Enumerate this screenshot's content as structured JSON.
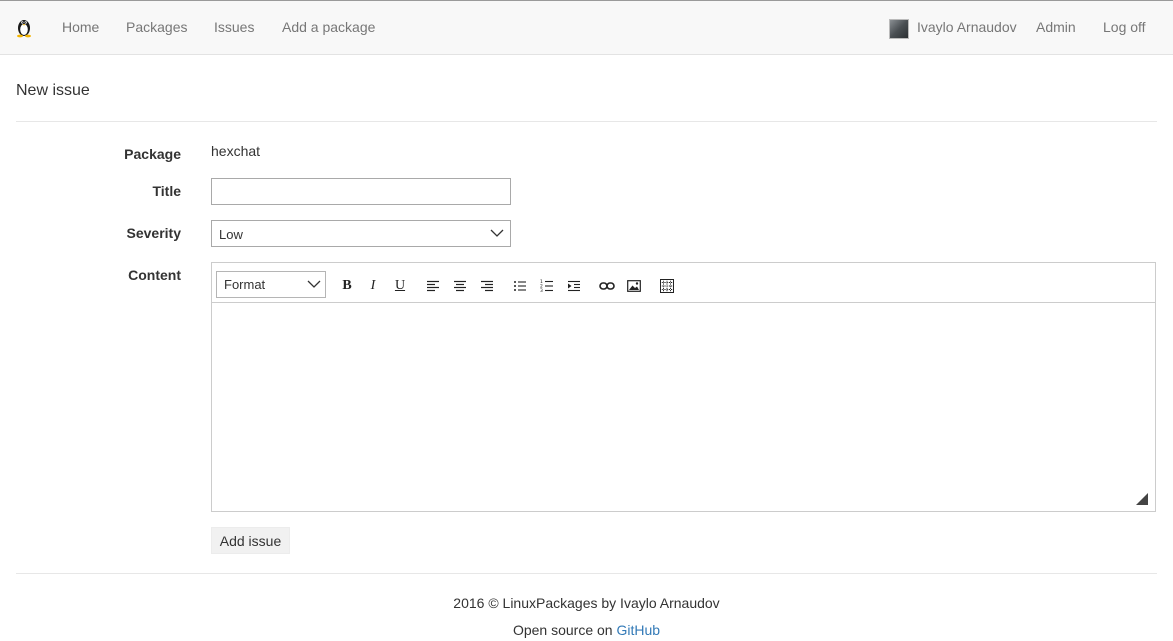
{
  "navbar": {
    "brand_icon": "tux-penguin-icon",
    "links": {
      "home": "Home",
      "packages": "Packages",
      "issues": "Issues",
      "add_package": "Add a package"
    },
    "user_name": "Ivaylo Arnaudov",
    "admin": "Admin",
    "log_off": "Log off"
  },
  "page": {
    "title": "New issue"
  },
  "form": {
    "package_label": "Package",
    "package_value": "hexchat",
    "title_label": "Title",
    "title_value": "",
    "title_placeholder": "",
    "severity_label": "Severity",
    "severity_value": "Low",
    "content_label": "Content",
    "content_value": "",
    "submit_label": "Add issue"
  },
  "editor": {
    "format_label": "Format",
    "toolbar_icons": [
      "bold-icon",
      "italic-icon",
      "underline-icon",
      "align-left-icon",
      "align-center-icon",
      "align-right-icon",
      "bullet-list-icon",
      "numbered-list-icon",
      "indent-icon",
      "link-icon",
      "image-icon",
      "table-icon"
    ],
    "bold_glyph": "B",
    "italic_glyph": "I",
    "underline_glyph": "U"
  },
  "footer": {
    "copyright": "2016 © LinuxPackages by Ivaylo Arnaudov",
    "open_source_prefix": "Open source on",
    "github_link": "GitHub"
  },
  "colors": {
    "link_blue": "#337ab7",
    "navbar_bg": "#f8f8f8",
    "nav_text": "#777777"
  }
}
